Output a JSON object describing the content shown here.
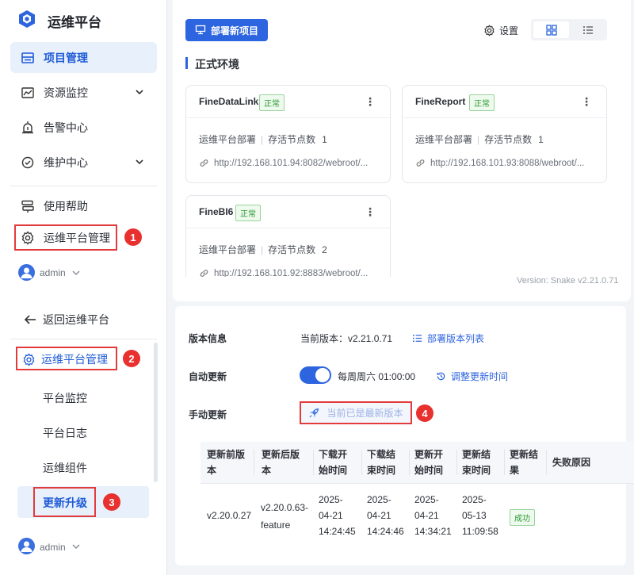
{
  "top": {
    "brand": "运维平台",
    "nav": [
      {
        "label": "项目管理"
      },
      {
        "label": "资源监控"
      },
      {
        "label": "告警中心"
      },
      {
        "label": "维护中心"
      },
      {
        "label": "使用帮助"
      },
      {
        "label": "运维平台管理"
      }
    ],
    "user": "admin",
    "deploy_button": "部署新项目",
    "settings": "设置",
    "section_title": "正式环境",
    "version": "Version: Snake v2.21.0.71",
    "cards": [
      {
        "name": "FineDataLink",
        "status": "正常",
        "kind": "运维平台部署",
        "nodes_label": "存活节点数",
        "nodes": "1",
        "url": "http://192.168.101.94:8082/webroot/..."
      },
      {
        "name": "FineReport",
        "status": "正常",
        "kind": "运维平台部署",
        "nodes_label": "存活节点数",
        "nodes": "1",
        "url": "http://192.168.101.93:8088/webroot/..."
      },
      {
        "name": "FineBI6",
        "status": "正常",
        "kind": "运维平台部署",
        "nodes_label": "存活节点数",
        "nodes": "2",
        "url": "http://192.168.101.92:8883/webroot/..."
      }
    ]
  },
  "bottom": {
    "back": "返回运维平台",
    "admin_menu": "运维平台管理",
    "sub_items": [
      "平台监控",
      "平台日志",
      "运维组件",
      "更新升级"
    ],
    "user": "admin",
    "version_info_label": "版本信息",
    "current_version": "当前版本：v2.21.0.71",
    "deploy_versions_link": "部署版本列表",
    "auto_update_label": "自动更新",
    "auto_update_schedule": "每周周六 01:00:00",
    "adjust_time_link": "调整更新时间",
    "manual_update_label": "手动更新",
    "latest_button": "当前已是最新版本",
    "table": {
      "headers": [
        [
          "更新前版",
          "本"
        ],
        [
          "更新后版",
          "本"
        ],
        [
          "下载开",
          "始时间"
        ],
        [
          "下载结",
          "束时间"
        ],
        [
          "更新开",
          "始时间"
        ],
        [
          "更新结",
          "束时间"
        ],
        [
          "更新结",
          "果"
        ],
        [
          "失败原因"
        ]
      ],
      "row": {
        "before": "v2.20.0.27",
        "after": [
          "v2.20.0.63-",
          "feature"
        ],
        "dl_start": [
          "2025-",
          "04-21",
          "14:24:45"
        ],
        "dl_end": [
          "2025-",
          "04-21",
          "14:24:46"
        ],
        "up_start": [
          "2025-",
          "04-21",
          "14:34:21"
        ],
        "up_end": [
          "2025-",
          "05-13",
          "11:09:58"
        ],
        "result": "成功",
        "reason": ""
      }
    }
  },
  "badges": [
    "1",
    "2",
    "3",
    "4"
  ],
  "colors": {
    "accent": "#2d64df",
    "annotation_red": "#e23b3b",
    "success": "#2e9a36"
  }
}
